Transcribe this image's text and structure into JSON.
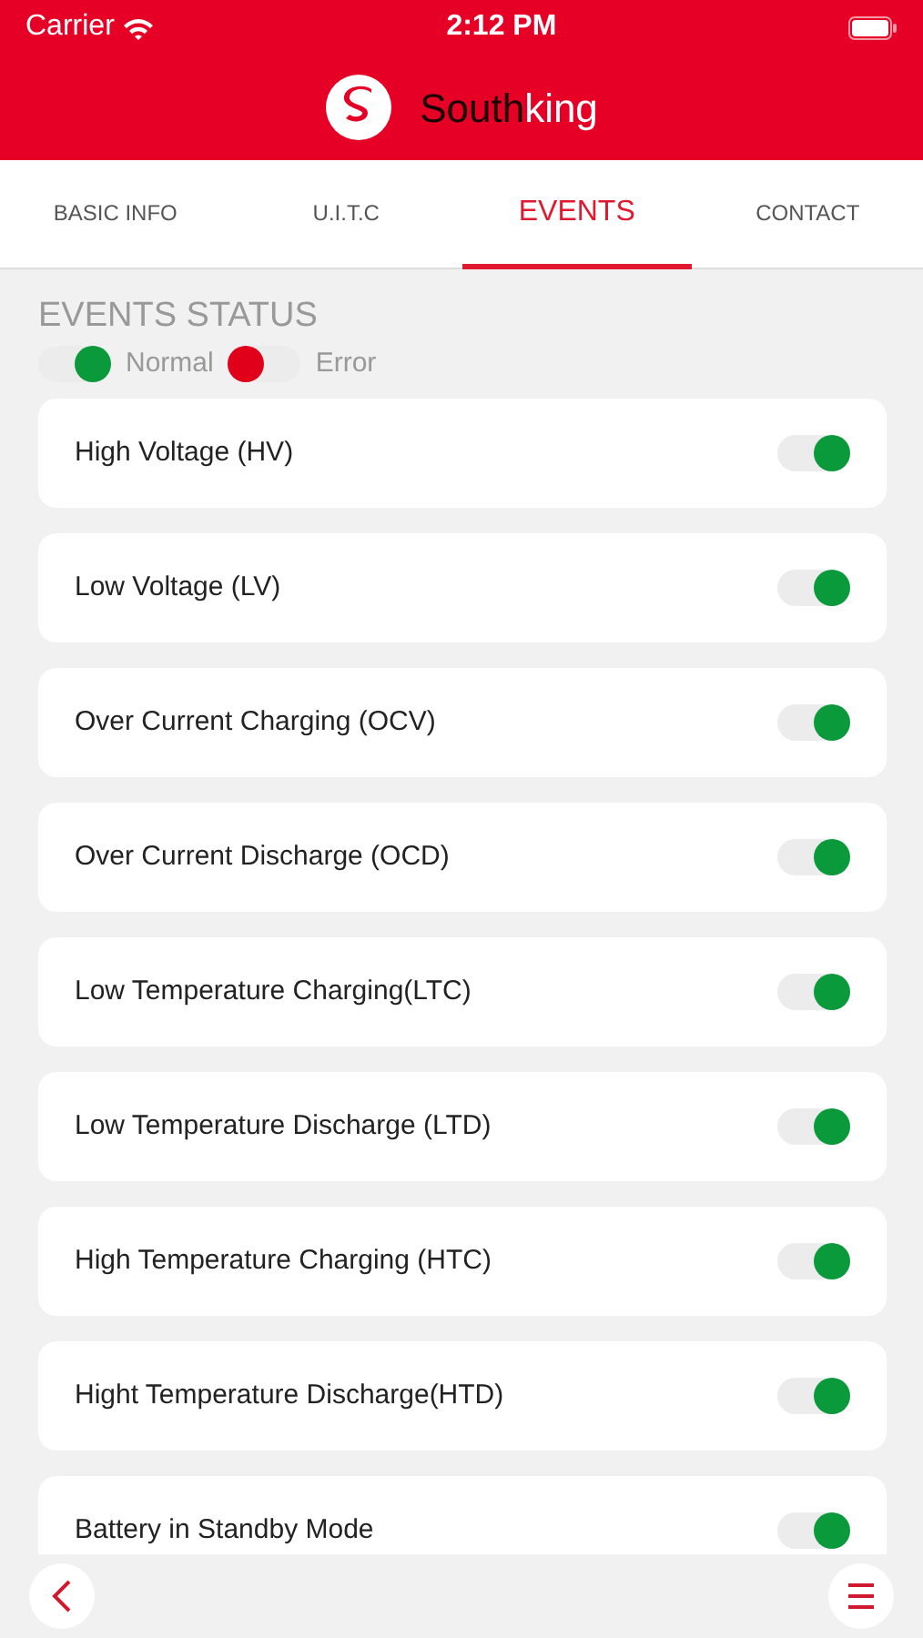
{
  "status_bar": {
    "carrier": "Carrier",
    "time": "2:12 PM"
  },
  "header": {
    "title_part_1": "South",
    "title_part_2": "king"
  },
  "tabs": [
    {
      "label": "BASIC INFO",
      "selected": false
    },
    {
      "label": "U.I.T.C",
      "selected": false
    },
    {
      "label": "EVENTS",
      "selected": true
    },
    {
      "label": "CONTACT",
      "selected": false
    }
  ],
  "section_title": "EVENTS STATUS",
  "legend": [
    {
      "label": "Normal",
      "on": true
    },
    {
      "label": "Error",
      "on": false
    }
  ],
  "events": [
    {
      "label": "High Voltage (HV)",
      "on": true
    },
    {
      "label": "Low Voltage (LV)",
      "on": true
    },
    {
      "label": "Over Current Charging (OCV)",
      "on": true
    },
    {
      "label": "Over Current Discharge (OCD)",
      "on": true
    },
    {
      "label": "Low Temperature Charging(LTC)",
      "on": true
    },
    {
      "label": "Low Temperature Discharge (LTD)",
      "on": true
    },
    {
      "label": "High Temperature Charging (HTC)",
      "on": true
    },
    {
      "label": "Hight Temperature Discharge(HTD)",
      "on": true
    },
    {
      "label": "Battery in Standby Mode",
      "on": true
    }
  ]
}
